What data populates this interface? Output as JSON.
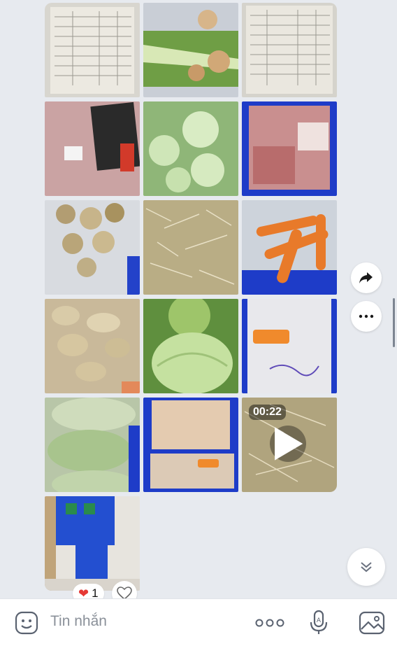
{
  "video": {
    "duration": "00:22"
  },
  "reaction": {
    "emoji": "❤",
    "count": "1"
  },
  "composer": {
    "placeholder": "Tin nhắn"
  },
  "icons": {
    "share": "share-forward-icon",
    "more": "more-options-icon",
    "scroll_down": "chevron-down-double-icon",
    "like": "heart-outline-icon",
    "sticker": "sticker-smile-icon",
    "more_composer": "ellipsis-icon",
    "voice": "microphone-icon",
    "image": "image-icon"
  },
  "colors": {
    "accent": "#e53935",
    "blue_crate": "#1e3cc8"
  }
}
